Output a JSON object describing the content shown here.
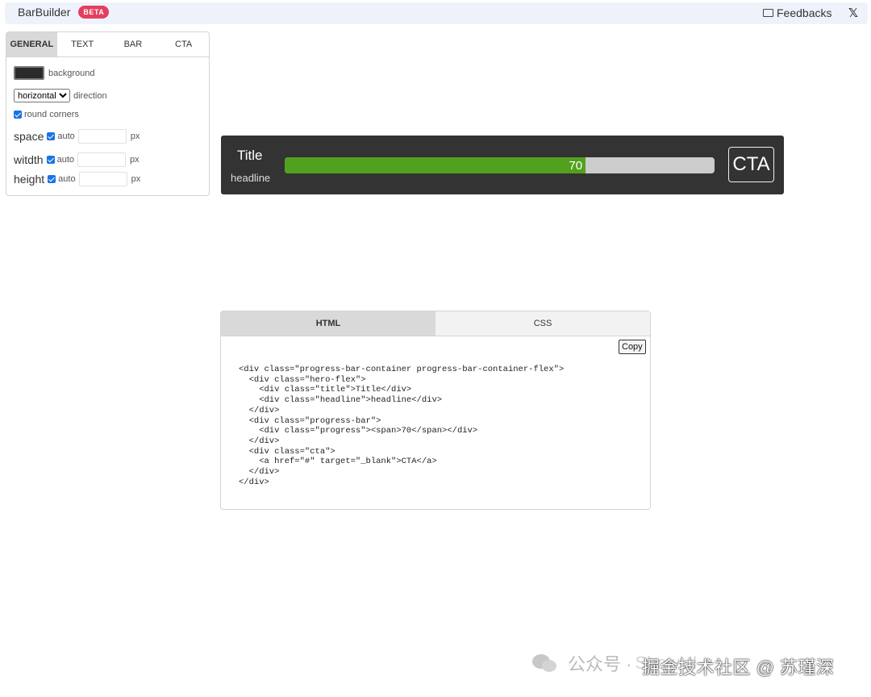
{
  "header": {
    "brand_glyph": "",
    "brand_name": "BarBuilder",
    "badge": "BETA",
    "feedback_label": "Feedbacks",
    "x_label": "𝕏"
  },
  "settings": {
    "tabs": [
      "GENERAL",
      "TEXT",
      "BAR",
      "CTA"
    ],
    "active_tab": "GENERAL",
    "background_color": "#2a2a2a",
    "background_label": "background",
    "direction_value": "horizontal",
    "direction_label": "direction",
    "round_corners_label": "round corners",
    "space_label": "space",
    "width_label": "witdth",
    "height_label": "height",
    "auto_label": "auto",
    "unit": "px"
  },
  "preview": {
    "title": "Title",
    "headline": "headline",
    "progress_percent": 70,
    "progress_text": "70",
    "cta": "CTA",
    "bar_color": "#333333",
    "fill_color": "#52a11e",
    "track_color": "#cccccc"
  },
  "code_panel": {
    "tabs": [
      "HTML",
      "CSS"
    ],
    "active_tab": "HTML",
    "copy_label": "Copy",
    "code": "<div class=\"progress-bar-container progress-bar-container-flex\">\n  <div class=\"hero-flex\">\n    <div class=\"title\">Title</div>\n    <div class=\"headline\">headline</div>\n  </div>\n  <div class=\"progress-bar\">\n    <div class=\"progress\"><span>70</span></div>\n  </div>\n  <div class=\"cta\">\n    <a href=\"#\" target=\"_blank\">CTA</a>\n  </div>\n</div>"
  },
  "watermark": {
    "prefix": "公众号 ·",
    "ghost": "ShowUI",
    "text": "掘金技术社区 @ 苏瑾深"
  }
}
